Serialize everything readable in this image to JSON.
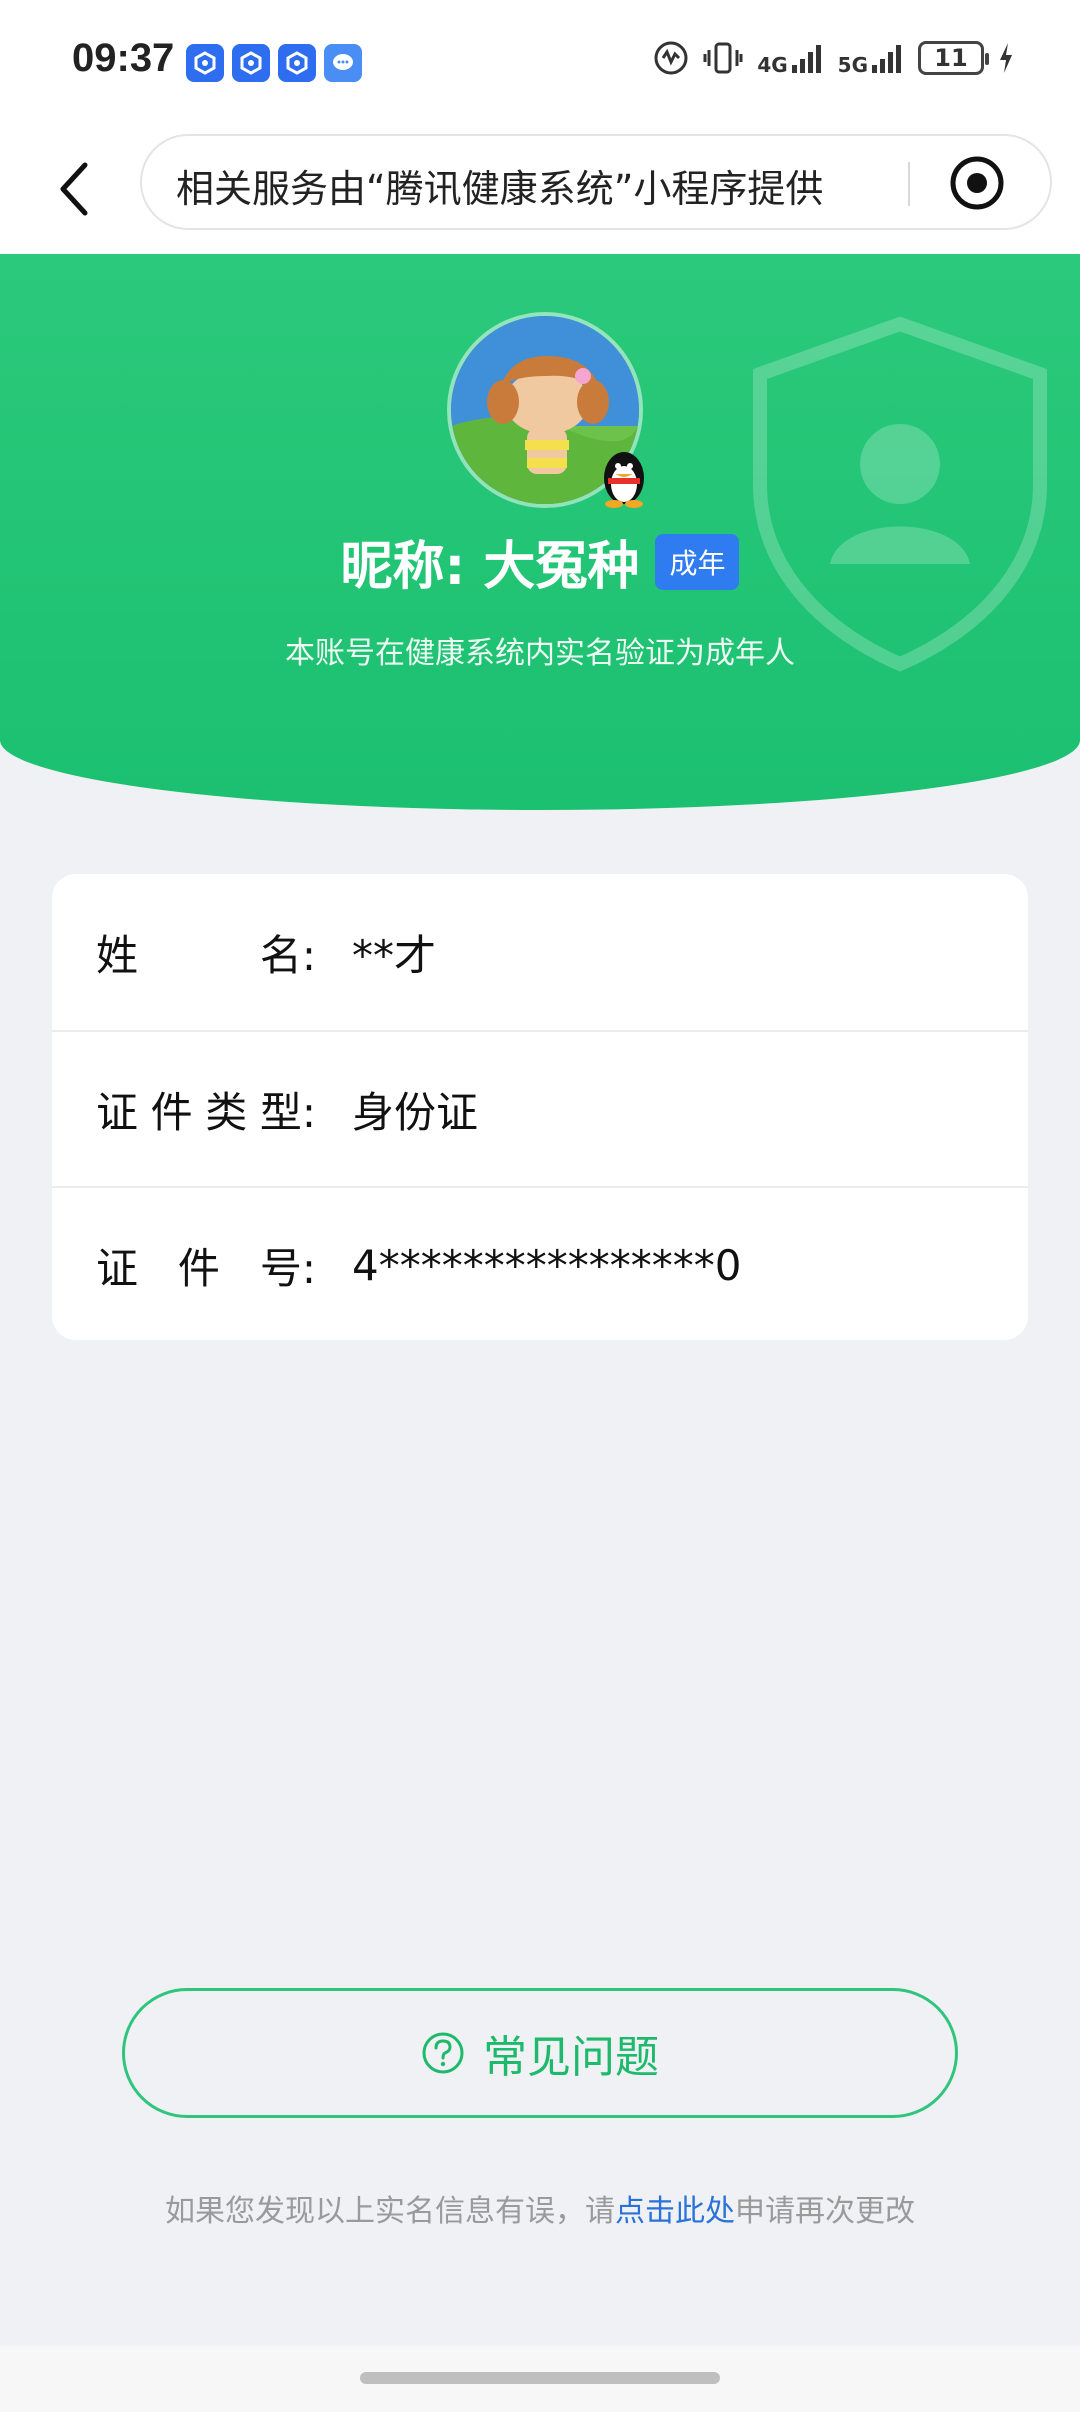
{
  "status_bar": {
    "time": "09:37",
    "net_4g": "4G",
    "net_5g": "5G",
    "battery": "11"
  },
  "nav": {
    "title": "相关服务由“腾讯健康系统”小程序提供"
  },
  "profile": {
    "nickname": "昵称: 大冤种",
    "badge": "成年",
    "subtext": "本账号在健康系统内实名验证为成年人"
  },
  "info": {
    "rows": [
      {
        "label_chars": [
          "姓",
          "名:"
        ],
        "value": "**才"
      },
      {
        "label_chars": [
          "证",
          "件",
          "类",
          "型:"
        ],
        "value": "身份证"
      },
      {
        "label_chars": [
          "证",
          "件",
          "号:"
        ],
        "value": "4****************0"
      }
    ]
  },
  "faq": {
    "label": "常见问题"
  },
  "footer": {
    "prefix": "如果您发现以上实名信息有误，请",
    "link": "点击此处",
    "suffix": "申请再次更改"
  },
  "colors": {
    "primary_green": "#1bc070",
    "link_blue": "#2a72d8",
    "badge_blue": "#2f7bf0"
  }
}
